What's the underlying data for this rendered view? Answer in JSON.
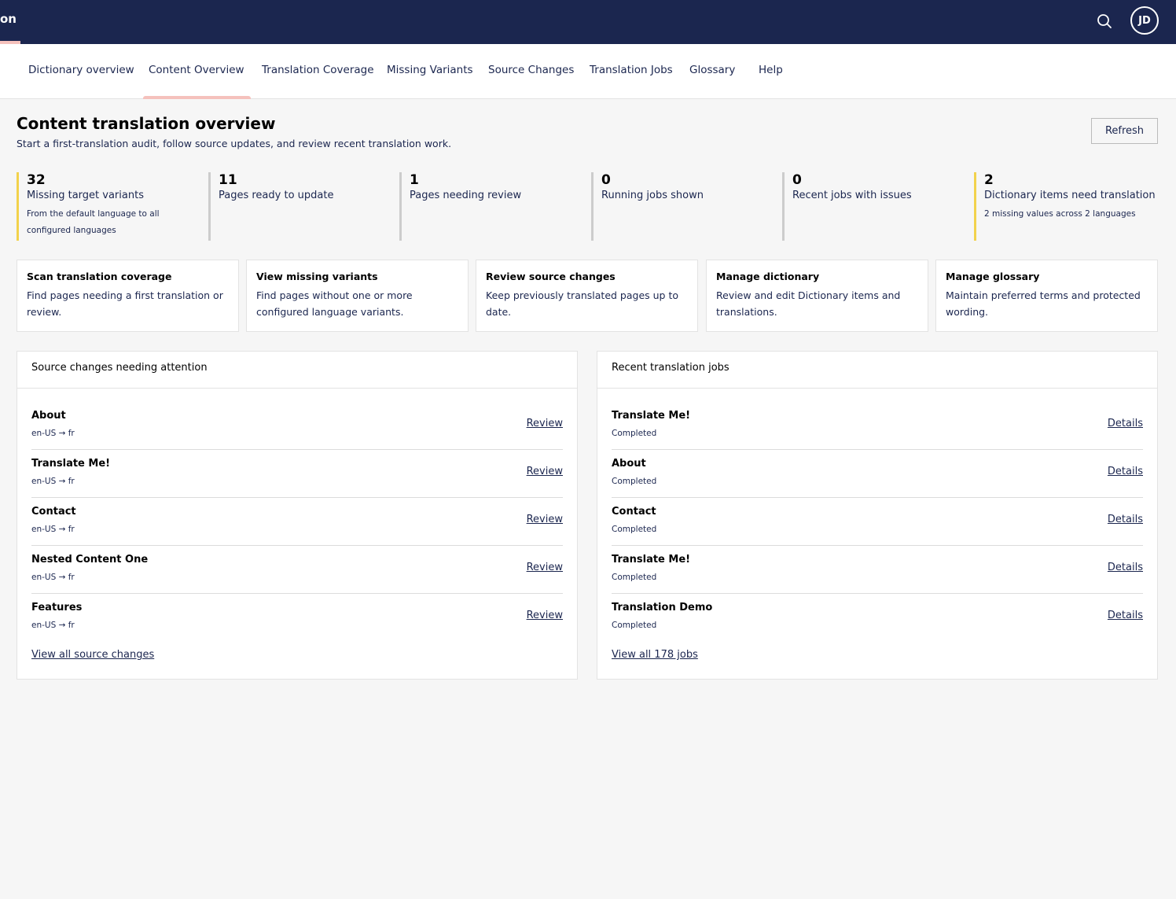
{
  "header": {
    "app_name_fragment": "on",
    "avatar_initials": "JD"
  },
  "tabs": [
    {
      "label": "Dictionary overview"
    },
    {
      "label": "Content Overview",
      "active": true
    },
    {
      "label": "Translation Coverage"
    },
    {
      "label": "Missing Variants"
    },
    {
      "label": "Source Changes"
    },
    {
      "label": "Translation Jobs"
    },
    {
      "label": "Glossary"
    },
    {
      "label": "Help"
    }
  ],
  "page": {
    "title": "Content translation overview",
    "subtitle": "Start a first-translation audit, follow source updates, and review recent translation work.",
    "refresh_label": "Refresh"
  },
  "stats": [
    {
      "value": "32",
      "label": "Missing target variants",
      "note": "From the default language to all configured languages"
    },
    {
      "value": "11",
      "label": "Pages ready to update",
      "note": ""
    },
    {
      "value": "1",
      "label": "Pages needing review",
      "note": ""
    },
    {
      "value": "0",
      "label": "Running jobs shown",
      "note": ""
    },
    {
      "value": "0",
      "label": "Recent jobs with issues",
      "note": ""
    },
    {
      "value": "2",
      "label": "Dictionary items need translation",
      "note": "2 missing values across 2 languages"
    }
  ],
  "actions": [
    {
      "title": "Scan translation coverage",
      "desc": "Find pages needing a first translation or review."
    },
    {
      "title": "View missing variants",
      "desc": "Find pages without one or more configured language variants."
    },
    {
      "title": "Review source changes",
      "desc": "Keep previously translated pages up to date."
    },
    {
      "title": "Manage dictionary",
      "desc": "Review and edit Dictionary items and translations."
    },
    {
      "title": "Manage glossary",
      "desc": "Maintain preferred terms and protected wording."
    }
  ],
  "source_changes": {
    "heading": "Source changes needing attention",
    "rows": [
      {
        "title": "About",
        "sub": "en-US → fr",
        "action": "Review"
      },
      {
        "title": "Translate Me!",
        "sub": "en-US → fr",
        "action": "Review"
      },
      {
        "title": "Contact",
        "sub": "en-US → fr",
        "action": "Review"
      },
      {
        "title": "Nested Content One",
        "sub": "en-US → fr",
        "action": "Review"
      },
      {
        "title": "Features",
        "sub": "en-US → fr",
        "action": "Review"
      }
    ],
    "view_all": "View all source changes"
  },
  "recent_jobs": {
    "heading": "Recent translation jobs",
    "rows": [
      {
        "title": "Translate Me!",
        "sub": "Completed",
        "action": "Details"
      },
      {
        "title": "About",
        "sub": "Completed",
        "action": "Details"
      },
      {
        "title": "Contact",
        "sub": "Completed",
        "action": "Details"
      },
      {
        "title": "Translate Me!",
        "sub": "Completed",
        "action": "Details"
      },
      {
        "title": "Translation Demo",
        "sub": "Completed",
        "action": "Details"
      }
    ],
    "view_all": "View all 178 jobs"
  },
  "colors": {
    "header_bg": "#1b264f",
    "accent_pink": "#f5c1bc",
    "warning_yellow": "#f2d24c"
  }
}
